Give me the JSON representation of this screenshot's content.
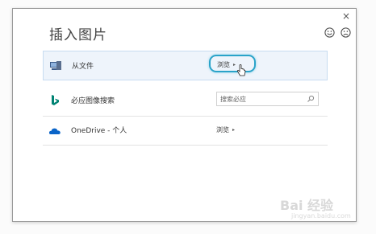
{
  "dialog": {
    "title": "插入图片",
    "close_glyph": "×",
    "feedback": {
      "smile_icon": "smiley-icon",
      "frown_icon": "frown-icon"
    }
  },
  "rows": [
    {
      "label": "从文件",
      "icon": "computer-icon",
      "action": "浏览",
      "action_arrow": "▸"
    },
    {
      "label": "必应图像搜索",
      "icon": "bing-icon",
      "search_placeholder": "搜索必应"
    },
    {
      "label": "OneDrive - 个人",
      "icon": "onedrive-cloud-icon",
      "action": "浏览",
      "action_arrow": "▸"
    }
  ],
  "watermark": {
    "text": "Bai 经验",
    "url": "jingyan.baidu.com"
  },
  "colors": {
    "highlight_ring": "#2aa3c9",
    "bing": "#008373",
    "onedrive": "#0a64c8",
    "row_selected": "#eef4fb"
  }
}
